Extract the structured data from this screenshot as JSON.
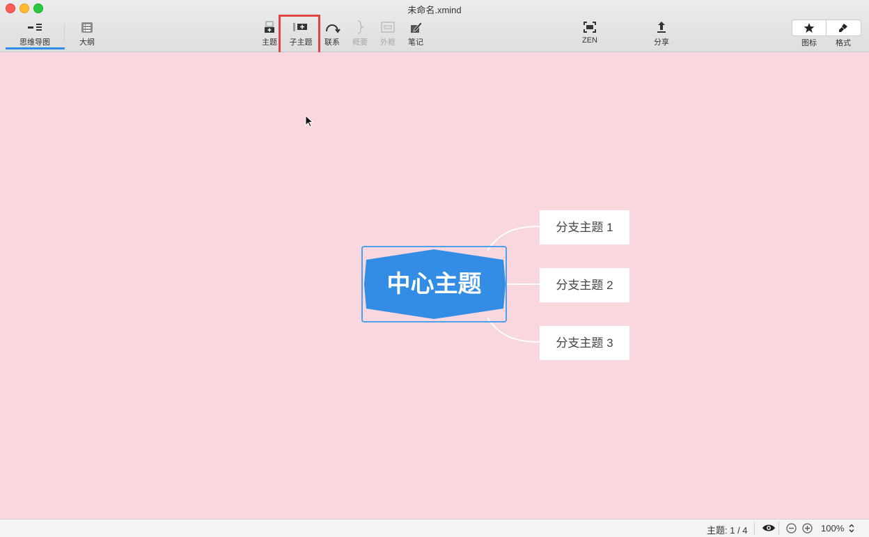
{
  "window": {
    "title": "未命名.xmind"
  },
  "toolbar": {
    "mindmap_label": "思维导图",
    "outline_label": "大纲",
    "topic_label": "主题",
    "subtopic_label": "子主题",
    "relationship_label": "联系",
    "summary_label": "概要",
    "boundary_label": "外框",
    "note_label": "笔记",
    "zen_label": "ZEN",
    "share_label": "分享",
    "icon_label": "图标",
    "format_label": "格式"
  },
  "map": {
    "central_topic": "中心主题",
    "branches": [
      "分支主题 1",
      "分支主题 2",
      "分支主题 3"
    ]
  },
  "statusbar": {
    "topic_count": "主题: 1 / 4",
    "zoom": "100%"
  },
  "colors": {
    "canvas": "#f8d7de",
    "central_fill": "#338de4",
    "selection": "#4ea0ee",
    "highlight": "#e0443e",
    "accent": "#2e8cf0"
  }
}
